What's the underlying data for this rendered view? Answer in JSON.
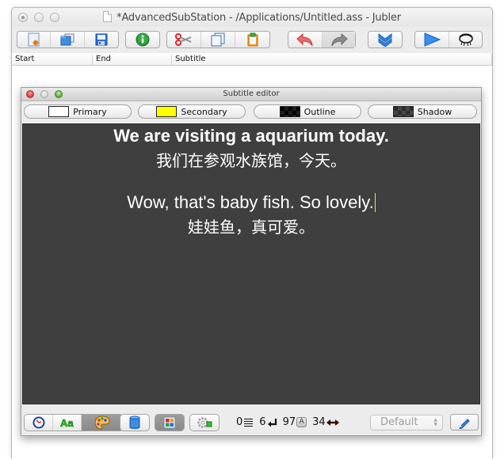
{
  "window": {
    "title": "*AdvancedSubStation - /Applications/Untitled.ass - Jubler",
    "toolbar": {
      "groups": [
        {
          "buttons": [
            {
              "icon": "new-file-icon",
              "label": "New"
            },
            {
              "icon": "open-file-icon",
              "label": "Open"
            },
            {
              "icon": "save-icon",
              "label": "Save"
            }
          ]
        },
        {
          "buttons": [
            {
              "icon": "info-icon",
              "label": "Info"
            }
          ]
        },
        {
          "buttons": [
            {
              "icon": "cut-icon",
              "label": "Cut"
            },
            {
              "icon": "copy-icon",
              "label": "Copy"
            },
            {
              "icon": "paste-icon",
              "label": "Paste"
            }
          ]
        },
        {
          "buttons": [
            {
              "icon": "undo-icon",
              "label": "Undo"
            },
            {
              "icon": "redo-icon",
              "label": "Redo"
            }
          ]
        },
        {
          "buttons": [
            {
              "icon": "join-down-icon",
              "label": "Join"
            }
          ]
        },
        {
          "buttons": [
            {
              "icon": "play-icon",
              "label": "Play"
            },
            {
              "icon": "preview-eye-icon",
              "label": "Preview"
            }
          ]
        }
      ]
    },
    "table": {
      "columns": [
        "Start",
        "End",
        "Subtitle"
      ]
    }
  },
  "editor": {
    "title": "Subtitle editor",
    "colors": [
      {
        "label": "Primary",
        "color": "#ffffff"
      },
      {
        "label": "Secondary",
        "color": "#ffff00"
      },
      {
        "label": "Outline",
        "color": "#000000"
      },
      {
        "label": "Shadow",
        "color": "#2e2e2e"
      }
    ],
    "text_lines": [
      "We are visiting a aquarium today.",
      "我们在参观水族馆，今天。",
      "Wow, that's baby fish. So lovely.",
      "娃娃鱼，真可爱。"
    ],
    "caret_color": "#f2ea2a",
    "bottom": {
      "stats": {
        "lines": "0",
        "newlines": "6",
        "chars": "97",
        "chars_badge": "A",
        "width": "34"
      },
      "style_select": {
        "value": "Default"
      }
    }
  }
}
